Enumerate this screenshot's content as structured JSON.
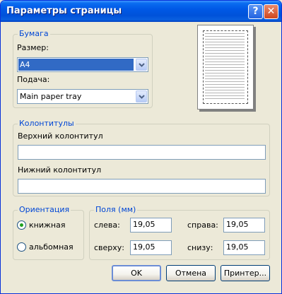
{
  "window": {
    "title": "Параметры страницы",
    "help_label": "?",
    "close_label": "✕"
  },
  "paper": {
    "legend": "Бумага",
    "size_label": "Размер:",
    "size_value": "A4",
    "source_label": "Подача:",
    "source_value": "Main paper tray"
  },
  "headers": {
    "legend": "Колонтитулы",
    "header_label": "Верхний колонтитул",
    "header_value": "",
    "footer_label": "Нижний колонтитул",
    "footer_value": ""
  },
  "orientation": {
    "legend": "Ориентация",
    "portrait_label": "книжная",
    "landscape_label": "альбомная",
    "selected": "portrait"
  },
  "margins": {
    "legend": "Поля (мм)",
    "left_label": "слева:",
    "left_value": "19,05",
    "right_label": "справа:",
    "right_value": "19,05",
    "top_label": "сверху:",
    "top_value": "19,05",
    "bottom_label": "снизу:",
    "bottom_value": "19,05"
  },
  "buttons": {
    "ok": "OK",
    "cancel": "Отмена",
    "printer": "Принтер..."
  },
  "icons": {
    "dropdown": "chevron-down-icon",
    "preview": "page-preview-icon"
  }
}
